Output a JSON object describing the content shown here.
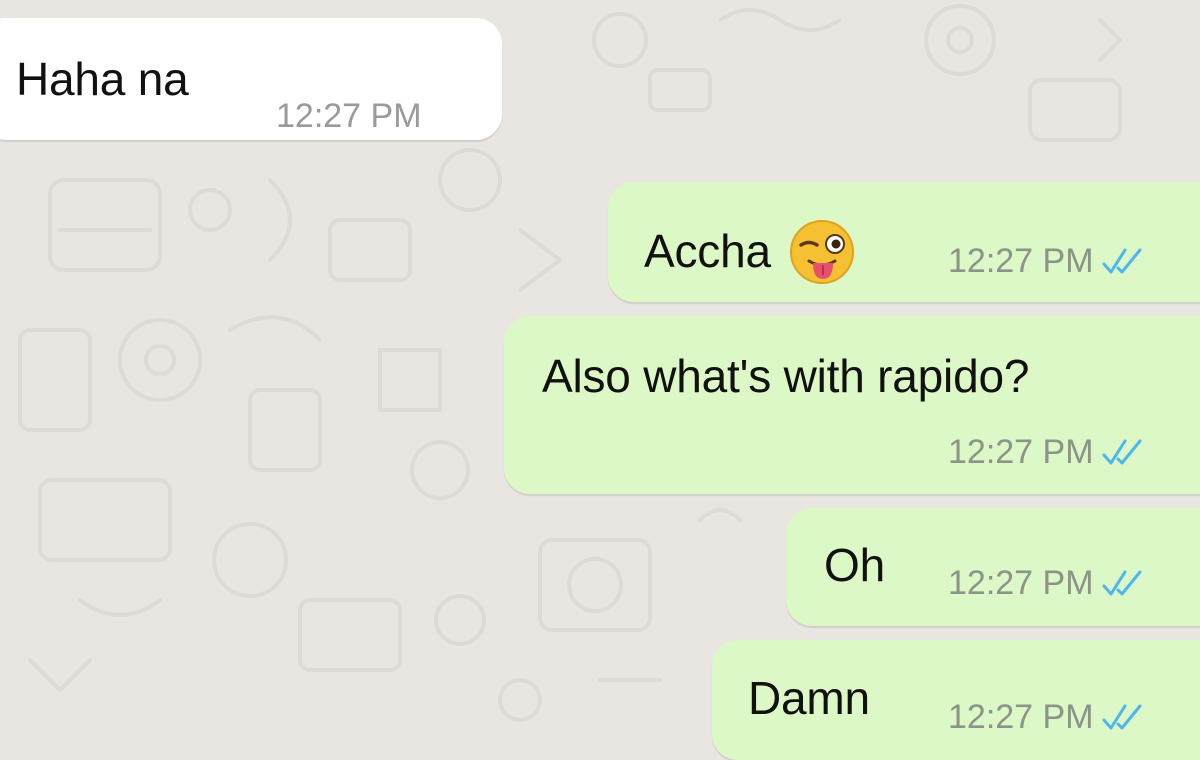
{
  "chat": {
    "messages": [
      {
        "direction": "incoming",
        "text": "Haha na",
        "time": "12:27 PM"
      },
      {
        "direction": "outgoing",
        "text": "Accha",
        "emoji": "winking-face-with-tongue-icon",
        "time": "12:27 PM",
        "status": "read"
      },
      {
        "direction": "outgoing",
        "text": "Also what's with rapido?",
        "time": "12:27 PM",
        "status": "read"
      },
      {
        "direction": "outgoing",
        "text": "Oh",
        "time": "12:27 PM",
        "status": "read"
      },
      {
        "direction": "outgoing",
        "text": "Damn",
        "time": "12:27 PM",
        "status": "read"
      }
    ]
  },
  "colors": {
    "wallpaper": "#e9e6e2",
    "incoming_bubble": "#ffffff",
    "outgoing_bubble": "#dcf8c6",
    "read_ticks": "#4fb6ec",
    "timestamp": "#8c9389"
  }
}
